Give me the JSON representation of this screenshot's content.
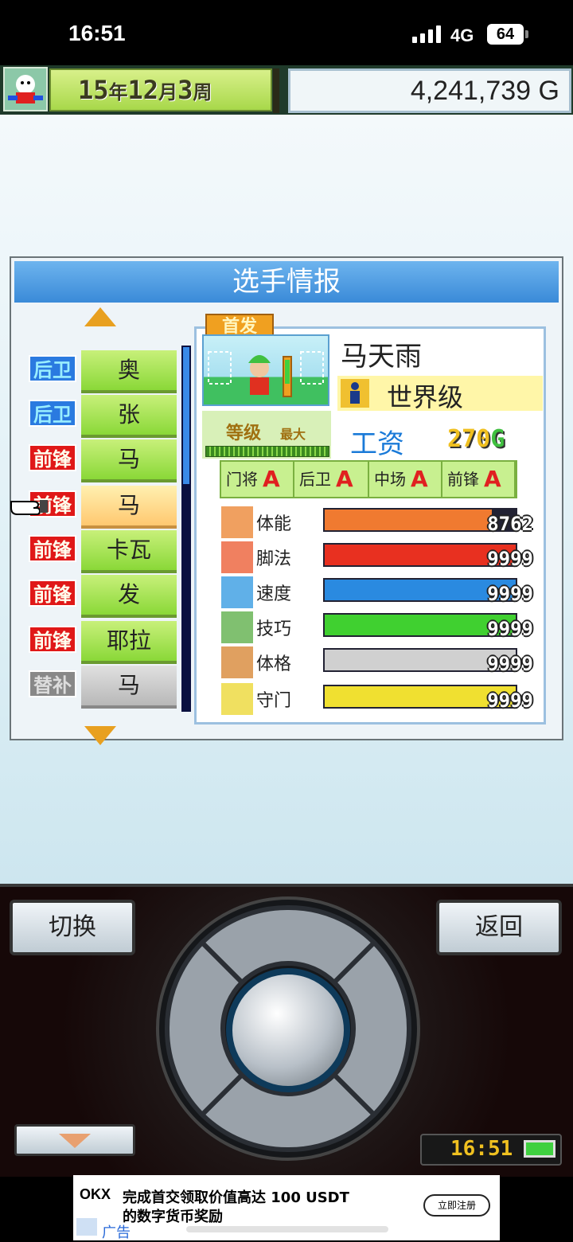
{
  "status_bar": {
    "time": "16:51",
    "network": "4G",
    "battery": "64"
  },
  "header": {
    "date": {
      "year": "15",
      "year_unit": "年",
      "month": "12",
      "month_unit": "月",
      "week": "3",
      "week_unit": "周"
    },
    "money": "4,241,739",
    "currency": "G"
  },
  "panel": {
    "title": "选手情报",
    "players": [
      {
        "position": "后卫",
        "name": "奥",
        "type": "def"
      },
      {
        "position": "后卫",
        "name": "张",
        "type": "def"
      },
      {
        "position": "前锋",
        "name": "马",
        "type": "fwd"
      },
      {
        "position": "前锋",
        "name": "马",
        "type": "fwd",
        "selected": true
      },
      {
        "position": "前锋",
        "name": "卡瓦",
        "type": "fwd"
      },
      {
        "position": "前锋",
        "name": "发",
        "type": "fwd"
      },
      {
        "position": "前锋",
        "name": "耶拉",
        "type": "fwd"
      },
      {
        "position": "替补",
        "name": "马",
        "type": "sub"
      }
    ]
  },
  "detail": {
    "tag": "首发",
    "name": "马天雨",
    "rank": "世界级",
    "level_label": "等级",
    "level_max": "最大",
    "salary_label": "工资",
    "salary_value": "270",
    "salary_unit": "G",
    "aptitudes": [
      {
        "label": "门将",
        "grade": "A"
      },
      {
        "label": "后卫",
        "grade": "A"
      },
      {
        "label": "中场",
        "grade": "A"
      },
      {
        "label": "前锋",
        "grade": "A"
      }
    ],
    "stats": [
      {
        "label": "体能",
        "value": "8762",
        "fill": 0.876,
        "color": "#f07a30",
        "icon": "battery-icon"
      },
      {
        "label": "脚法",
        "value": "9999",
        "fill": 1.0,
        "color": "#e83020",
        "icon": "boot-icon"
      },
      {
        "label": "速度",
        "value": "9999",
        "fill": 1.0,
        "color": "#2a8ae0",
        "icon": "runner-icon"
      },
      {
        "label": "技巧",
        "value": "9999",
        "fill": 1.0,
        "color": "#40d030",
        "icon": "dribble-icon"
      },
      {
        "label": "体格",
        "value": "9999",
        "fill": 1.0,
        "color": "#d0d0d0",
        "icon": "muscle-icon"
      },
      {
        "label": "守门",
        "value": "9999",
        "fill": 1.0,
        "color": "#f0e030",
        "icon": "glove-icon"
      }
    ]
  },
  "controller": {
    "switch_label": "切换",
    "back_label": "返回",
    "clock": "16:51"
  },
  "ad": {
    "logo": "OKX",
    "line1": "完成首交领取价值高达 100 USDT",
    "line2": "的数字货币奖励",
    "label": "广告",
    "button": "立即注册"
  }
}
